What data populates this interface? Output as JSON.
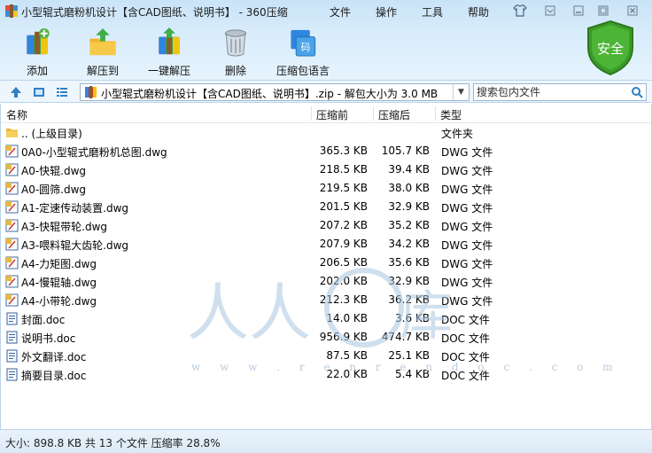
{
  "window": {
    "title": "小型辊式磨粉机设计【含CAD图纸、说明书】 - 360压缩"
  },
  "menu": [
    "文件",
    "操作",
    "工具",
    "帮助"
  ],
  "toolbar": [
    {
      "label": "添加",
      "icon": "add-archive-icon"
    },
    {
      "label": "解压到",
      "icon": "extract-to-icon"
    },
    {
      "label": "一键解压",
      "icon": "one-click-extract-icon"
    },
    {
      "label": "删除",
      "icon": "delete-trash-icon"
    },
    {
      "label": "压缩包语言",
      "icon": "archive-language-icon"
    }
  ],
  "security_badge": "安全",
  "address": {
    "path": "小型辊式磨粉机设计【含CAD图纸、说明书】.zip - 解包大小为 3.0 MB"
  },
  "search": {
    "placeholder": "搜索包内文件"
  },
  "columns": {
    "name": "名称",
    "packed": "压缩前",
    "compressed": "压缩后",
    "type": "类型"
  },
  "files": [
    {
      "name": ".. (上级目录)",
      "packed": "",
      "compressed": "",
      "type": "文件夹",
      "kind": "folder"
    },
    {
      "name": "0A0-小型辊式磨粉机总图.dwg",
      "packed": "365.3 KB",
      "compressed": "105.7 KB",
      "type": "DWG 文件",
      "kind": "dwg"
    },
    {
      "name": "A0-快辊.dwg",
      "packed": "218.5 KB",
      "compressed": "39.4 KB",
      "type": "DWG 文件",
      "kind": "dwg"
    },
    {
      "name": "A0-圆筛.dwg",
      "packed": "219.5 KB",
      "compressed": "38.0 KB",
      "type": "DWG 文件",
      "kind": "dwg"
    },
    {
      "name": "A1-定速传动装置.dwg",
      "packed": "201.5 KB",
      "compressed": "32.9 KB",
      "type": "DWG 文件",
      "kind": "dwg"
    },
    {
      "name": "A3-快辊带轮.dwg",
      "packed": "207.2 KB",
      "compressed": "35.2 KB",
      "type": "DWG 文件",
      "kind": "dwg"
    },
    {
      "name": "A3-喂料辊大齿轮.dwg",
      "packed": "207.9 KB",
      "compressed": "34.2 KB",
      "type": "DWG 文件",
      "kind": "dwg"
    },
    {
      "name": "A4-力矩图.dwg",
      "packed": "206.5 KB",
      "compressed": "35.6 KB",
      "type": "DWG 文件",
      "kind": "dwg"
    },
    {
      "name": "A4-慢辊轴.dwg",
      "packed": "202.0 KB",
      "compressed": "32.9 KB",
      "type": "DWG 文件",
      "kind": "dwg"
    },
    {
      "name": "A4-小带轮.dwg",
      "packed": "212.3 KB",
      "compressed": "36.2 KB",
      "type": "DWG 文件",
      "kind": "dwg"
    },
    {
      "name": "封面.doc",
      "packed": "14.0 KB",
      "compressed": "3.6 KB",
      "type": "DOC 文件",
      "kind": "doc"
    },
    {
      "name": "说明书.doc",
      "packed": "956.9 KB",
      "compressed": "474.7 KB",
      "type": "DOC 文件",
      "kind": "doc"
    },
    {
      "name": "外文翻译.doc",
      "packed": "87.5 KB",
      "compressed": "25.1 KB",
      "type": "DOC 文件",
      "kind": "doc"
    },
    {
      "name": "摘要目录.doc",
      "packed": "22.0 KB",
      "compressed": "5.4 KB",
      "type": "DOC 文件",
      "kind": "doc"
    }
  ],
  "watermark_url": "w w w . r e n r e n d o c . c o m",
  "status": "大小: 898.8 KB 共 13 个文件 压缩率 28.8%",
  "colors": {
    "accent": "#2f7fc4",
    "shield": "#3d9a2a",
    "folder": "#e7b93e"
  }
}
